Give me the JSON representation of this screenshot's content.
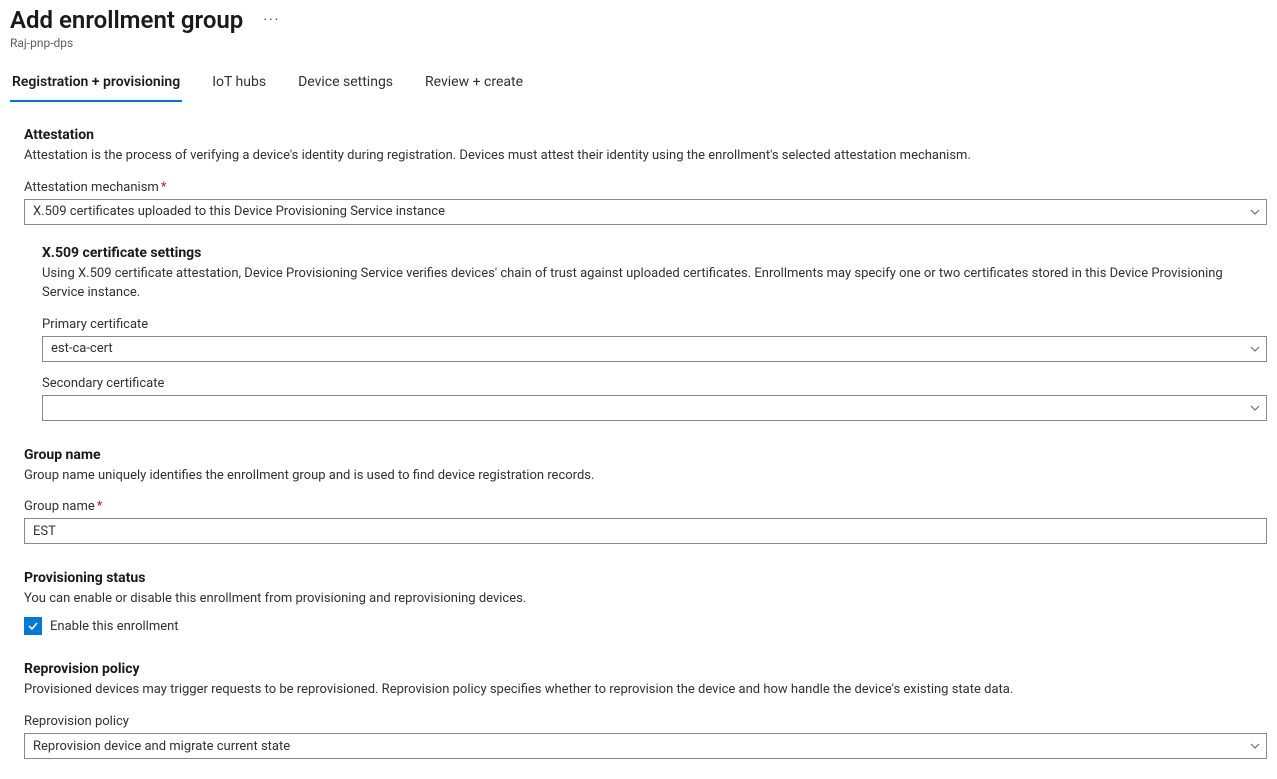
{
  "header": {
    "title": "Add enrollment group",
    "subtitle": "Raj-pnp-dps"
  },
  "tabs": [
    {
      "label": "Registration + provisioning",
      "active": true
    },
    {
      "label": "IoT hubs",
      "active": false
    },
    {
      "label": "Device settings",
      "active": false
    },
    {
      "label": "Review + create",
      "active": false
    }
  ],
  "attestation": {
    "heading": "Attestation",
    "desc": "Attestation is the process of verifying a device's identity during registration. Devices must attest their identity using the enrollment's selected attestation mechanism.",
    "mechanism_label": "Attestation mechanism",
    "mechanism_value": "X.509 certificates uploaded to this Device Provisioning Service instance"
  },
  "x509": {
    "heading": "X.509 certificate settings",
    "desc": "Using X.509 certificate attestation, Device Provisioning Service verifies devices' chain of trust against uploaded certificates. Enrollments may specify one or two certificates stored in this Device Provisioning Service instance.",
    "primary_label": "Primary certificate",
    "primary_value": "est-ca-cert",
    "secondary_label": "Secondary certificate",
    "secondary_value": ""
  },
  "group": {
    "heading": "Group name",
    "desc": "Group name uniquely identifies the enrollment group and is used to find device registration records.",
    "name_label": "Group name",
    "name_value": "EST"
  },
  "provisioning": {
    "heading": "Provisioning status",
    "desc": "You can enable or disable this enrollment from provisioning and reprovisioning devices.",
    "enable_label": "Enable this enrollment",
    "enable_checked": true
  },
  "reprovision": {
    "heading": "Reprovision policy",
    "desc": "Provisioned devices may trigger requests to be reprovisioned. Reprovision policy specifies whether to reprovision the device and how handle the device's existing state data.",
    "policy_label": "Reprovision policy",
    "policy_value": "Reprovision device and migrate current state"
  }
}
